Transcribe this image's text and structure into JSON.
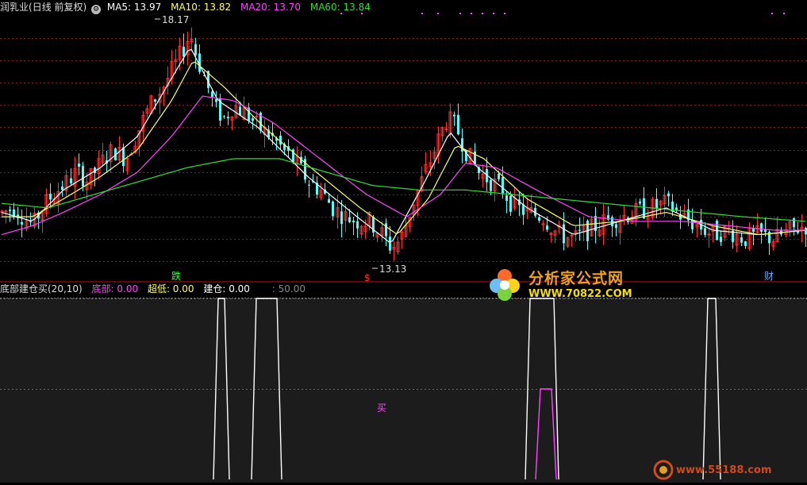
{
  "header": {
    "name": "润乳业",
    "period": "(日线 前复权)",
    "gear_glyph": "⚙",
    "ma": [
      {
        "label": "MA5: 13.97",
        "color": "#ffffff"
      },
      {
        "label": "MA10: 13.82",
        "color": "#ffff66"
      },
      {
        "label": "MA20: 13.70",
        "color": "#ff44ff"
      },
      {
        "label": "MA60: 13.84",
        "color": "#33dd33"
      }
    ]
  },
  "indicator_header": {
    "name": "底部建仓买(20,10)",
    "bottom": "底部: 0.00",
    "oversold": "超低: 0.00",
    "build": "建仓: 0.00",
    "level": ": 50.00"
  },
  "annotations": {
    "high": "18.17",
    "low": "13.13",
    "die": "跌",
    "dollar": "$",
    "cai": "财",
    "mai": "买"
  },
  "watermarks": {
    "cn_name": "分析家公式网",
    "url": "WWW.70822.COM",
    "url2": "www.55188.com"
  },
  "colors": {
    "up": "#ff3232",
    "down": "#54fcfc",
    "ma5": "#ffffff",
    "ma10": "#ffff66",
    "ma20": "#ff44ff",
    "ma60": "#33dd33",
    "grid": "#8a1c1c",
    "divider": "#c01010"
  },
  "chart_data": [
    {
      "type": "candlestick",
      "ylim": [
        12.6,
        18.6
      ],
      "grid_levels": [
        13.0,
        13.5,
        14.0,
        14.5,
        15.0,
        15.5,
        16.0,
        16.5,
        17.0,
        17.5,
        18.0
      ],
      "high_annotation": 18.17,
      "low_annotation": 13.13,
      "close_path": [
        [
          0,
          14.1
        ],
        [
          8,
          14.2
        ],
        [
          14,
          14.0
        ],
        [
          20,
          13.8
        ],
        [
          26,
          14.2
        ],
        [
          33,
          14.5
        ],
        [
          40,
          14.7
        ],
        [
          48,
          15.0
        ],
        [
          56,
          14.8
        ],
        [
          64,
          15.2
        ],
        [
          72,
          15.5
        ],
        [
          80,
          15.3
        ],
        [
          88,
          15.9
        ],
        [
          96,
          16.5
        ],
        [
          104,
          16.9
        ],
        [
          112,
          17.4
        ],
        [
          118,
          17.8
        ],
        [
          122,
          18.1
        ],
        [
          126,
          17.6
        ],
        [
          132,
          17.0
        ],
        [
          138,
          16.4
        ],
        [
          144,
          16.2
        ],
        [
          150,
          16.5
        ],
        [
          158,
          16.3
        ],
        [
          166,
          16.0
        ],
        [
          174,
          15.8
        ],
        [
          182,
          15.5
        ],
        [
          190,
          15.2
        ],
        [
          198,
          14.8
        ],
        [
          206,
          14.6
        ],
        [
          214,
          14.2
        ],
        [
          222,
          14.0
        ],
        [
          230,
          13.9
        ],
        [
          238,
          13.9
        ],
        [
          246,
          13.6
        ],
        [
          252,
          13.3
        ],
        [
          258,
          13.5
        ],
        [
          266,
          14.3
        ],
        [
          274,
          15.0
        ],
        [
          282,
          15.7
        ],
        [
          288,
          16.2
        ],
        [
          294,
          16.0
        ],
        [
          300,
          15.5
        ],
        [
          308,
          15.0
        ],
        [
          316,
          14.8
        ],
        [
          324,
          14.6
        ],
        [
          332,
          14.2
        ],
        [
          340,
          14.1
        ],
        [
          350,
          14.0
        ],
        [
          360,
          13.6
        ],
        [
          370,
          13.5
        ],
        [
          380,
          13.7
        ],
        [
          390,
          13.9
        ],
        [
          400,
          14.0
        ],
        [
          410,
          14.1
        ],
        [
          420,
          14.2
        ],
        [
          430,
          14.3
        ],
        [
          440,
          14.0
        ],
        [
          450,
          13.8
        ],
        [
          460,
          13.6
        ],
        [
          470,
          13.7
        ],
        [
          480,
          13.5
        ],
        [
          490,
          13.6
        ],
        [
          500,
          13.5
        ],
        [
          510,
          13.7
        ],
        [
          520,
          13.8
        ]
      ],
      "ma_series": [
        {
          "name": "MA5",
          "color": "#ffffff",
          "path": [
            [
              0,
              14.1
            ],
            [
              20,
              13.9
            ],
            [
              40,
              14.6
            ],
            [
              64,
              15.1
            ],
            [
              88,
              15.8
            ],
            [
              110,
              17.1
            ],
            [
              122,
              17.8
            ],
            [
              140,
              16.6
            ],
            [
              166,
              16.0
            ],
            [
              198,
              14.9
            ],
            [
              230,
              14.0
            ],
            [
              252,
              13.4
            ],
            [
              274,
              14.8
            ],
            [
              290,
              15.9
            ],
            [
              308,
              15.1
            ],
            [
              340,
              14.2
            ],
            [
              370,
              13.6
            ],
            [
              400,
              13.9
            ],
            [
              430,
              14.2
            ],
            [
              460,
              13.7
            ],
            [
              490,
              13.6
            ],
            [
              520,
              13.7
            ]
          ]
        },
        {
          "name": "MA10",
          "color": "#ffff66",
          "path": [
            [
              0,
              14.0
            ],
            [
              20,
              14.0
            ],
            [
              40,
              14.4
            ],
            [
              64,
              14.9
            ],
            [
              88,
              15.5
            ],
            [
              110,
              16.6
            ],
            [
              124,
              17.5
            ],
            [
              144,
              16.9
            ],
            [
              170,
              16.0
            ],
            [
              200,
              15.1
            ],
            [
              232,
              14.2
            ],
            [
              256,
              13.6
            ],
            [
              276,
              14.4
            ],
            [
              294,
              15.6
            ],
            [
              312,
              15.3
            ],
            [
              340,
              14.4
            ],
            [
              370,
              13.8
            ],
            [
              400,
              13.9
            ],
            [
              430,
              14.1
            ],
            [
              460,
              13.8
            ],
            [
              490,
              13.6
            ],
            [
              520,
              13.7
            ]
          ]
        },
        {
          "name": "MA20",
          "color": "#ff44ff",
          "path": [
            [
              0,
              13.6
            ],
            [
              20,
              13.8
            ],
            [
              40,
              14.1
            ],
            [
              64,
              14.5
            ],
            [
              88,
              15.0
            ],
            [
              110,
              15.8
            ],
            [
              130,
              16.7
            ],
            [
              150,
              16.6
            ],
            [
              176,
              16.1
            ],
            [
              206,
              15.3
            ],
            [
              236,
              14.5
            ],
            [
              262,
              14.0
            ],
            [
              284,
              14.5
            ],
            [
              300,
              15.2
            ],
            [
              320,
              15.1
            ],
            [
              346,
              14.6
            ],
            [
              380,
              14.0
            ],
            [
              410,
              13.9
            ],
            [
              440,
              13.9
            ],
            [
              470,
              13.8
            ],
            [
              500,
              13.7
            ],
            [
              520,
              13.7
            ]
          ]
        },
        {
          "name": "MA60",
          "color": "#33dd33",
          "path": [
            [
              0,
              14.3
            ],
            [
              30,
              14.2
            ],
            [
              60,
              14.5
            ],
            [
              90,
              14.8
            ],
            [
              120,
              15.1
            ],
            [
              150,
              15.3
            ],
            [
              180,
              15.3
            ],
            [
              210,
              15.0
            ],
            [
              240,
              14.7
            ],
            [
              270,
              14.6
            ],
            [
              300,
              14.6
            ],
            [
              330,
              14.5
            ],
            [
              360,
              14.4
            ],
            [
              390,
              14.3
            ],
            [
              420,
              14.2
            ],
            [
              450,
              14.1
            ],
            [
              480,
              14.0
            ],
            [
              520,
              13.9
            ]
          ]
        }
      ]
    },
    {
      "type": "area",
      "ylim": [
        0,
        100
      ],
      "grid_levels": [
        50,
        100
      ],
      "series": [
        {
          "name": "建仓",
          "color": "#ffffff",
          "spikes": [
            [
              279,
              100
            ],
            [
              336,
              100
            ],
            [
              683,
              100
            ],
            [
              897,
              100
            ]
          ],
          "widths": [
            8,
            26,
            30,
            10
          ]
        },
        {
          "name": "底部",
          "color": "#ff44ff",
          "spikes": [
            [
              688,
              50
            ]
          ],
          "widths": [
            14
          ]
        }
      ]
    }
  ]
}
